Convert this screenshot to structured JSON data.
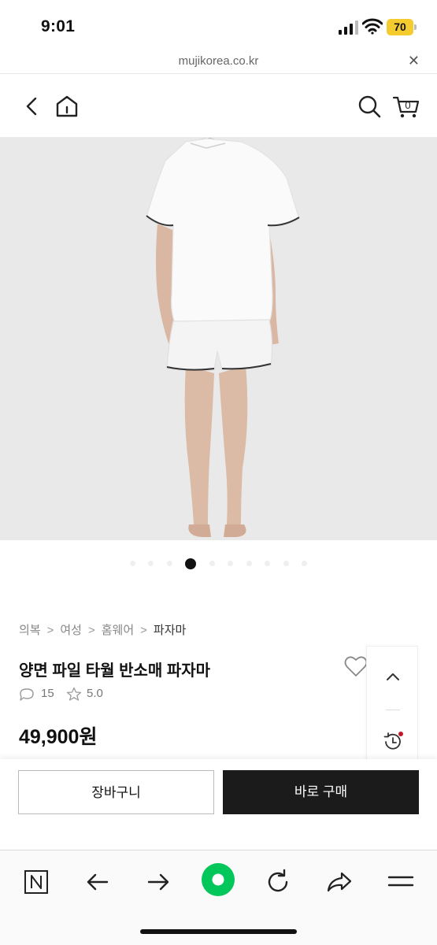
{
  "status_bar": {
    "time": "9:01",
    "battery": "70"
  },
  "browser": {
    "url": "mujikorea.co.kr",
    "close_icon": "close-icon"
  },
  "header": {
    "back_icon": "chevron-left-icon",
    "home_icon": "home-icon",
    "search_icon": "search-icon",
    "cart_icon": "cart-icon",
    "cart_count": "0"
  },
  "gallery": {
    "dot_count": 10,
    "active_index": 3
  },
  "product": {
    "breadcrumb": [
      "의복",
      "여성",
      "홈웨어",
      "파자마"
    ],
    "breadcrumb_sep": ">",
    "title": "양면 파일 타월 반소매 파자마",
    "review_count": "15",
    "rating": "5.0",
    "price": "49,900원"
  },
  "actions": {
    "cart_label": "장바구니",
    "buy_label": "바로 구매"
  },
  "colors": {
    "accent_dark": "#1b1b1b",
    "notice_red": "#c0182b",
    "naver_green": "#03c75a"
  }
}
